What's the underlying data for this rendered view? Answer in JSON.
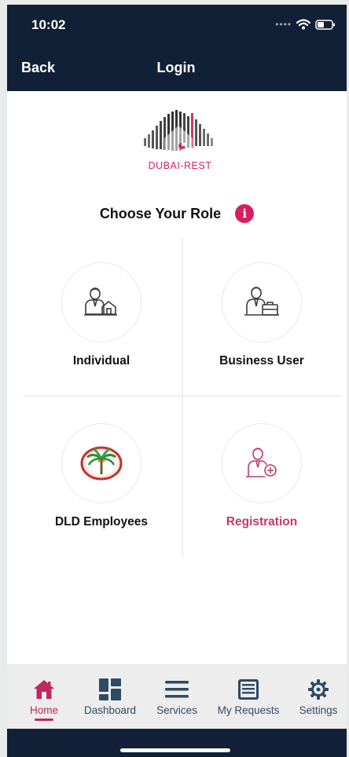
{
  "status": {
    "time": "10:02"
  },
  "nav": {
    "back_label": "Back",
    "title": "Login"
  },
  "logo": {
    "text": "DUBAI-REST"
  },
  "role_section": {
    "title": "Choose Your Role",
    "info_glyph": "i"
  },
  "roles": [
    {
      "label": "Individual",
      "icon": "individual-user-icon"
    },
    {
      "label": "Business User",
      "icon": "business-user-icon"
    },
    {
      "label": "DLD Employees",
      "icon": "dld-palm-logo-icon"
    },
    {
      "label": "Registration",
      "icon": "registration-user-icon"
    }
  ],
  "tabs": [
    {
      "label": "Home",
      "icon": "home-icon",
      "active": true
    },
    {
      "label": "Dashboard",
      "icon": "dashboard-icon"
    },
    {
      "label": "Services",
      "icon": "menu-lines-icon"
    },
    {
      "label": "My Requests",
      "icon": "requests-list-icon"
    },
    {
      "label": "Settings",
      "icon": "gear-icon"
    }
  ],
  "colors": {
    "header_bg": "#112036",
    "accent": "#d51f5e",
    "tab_active": "#c0285f",
    "tab_inactive": "#2e4a64"
  }
}
